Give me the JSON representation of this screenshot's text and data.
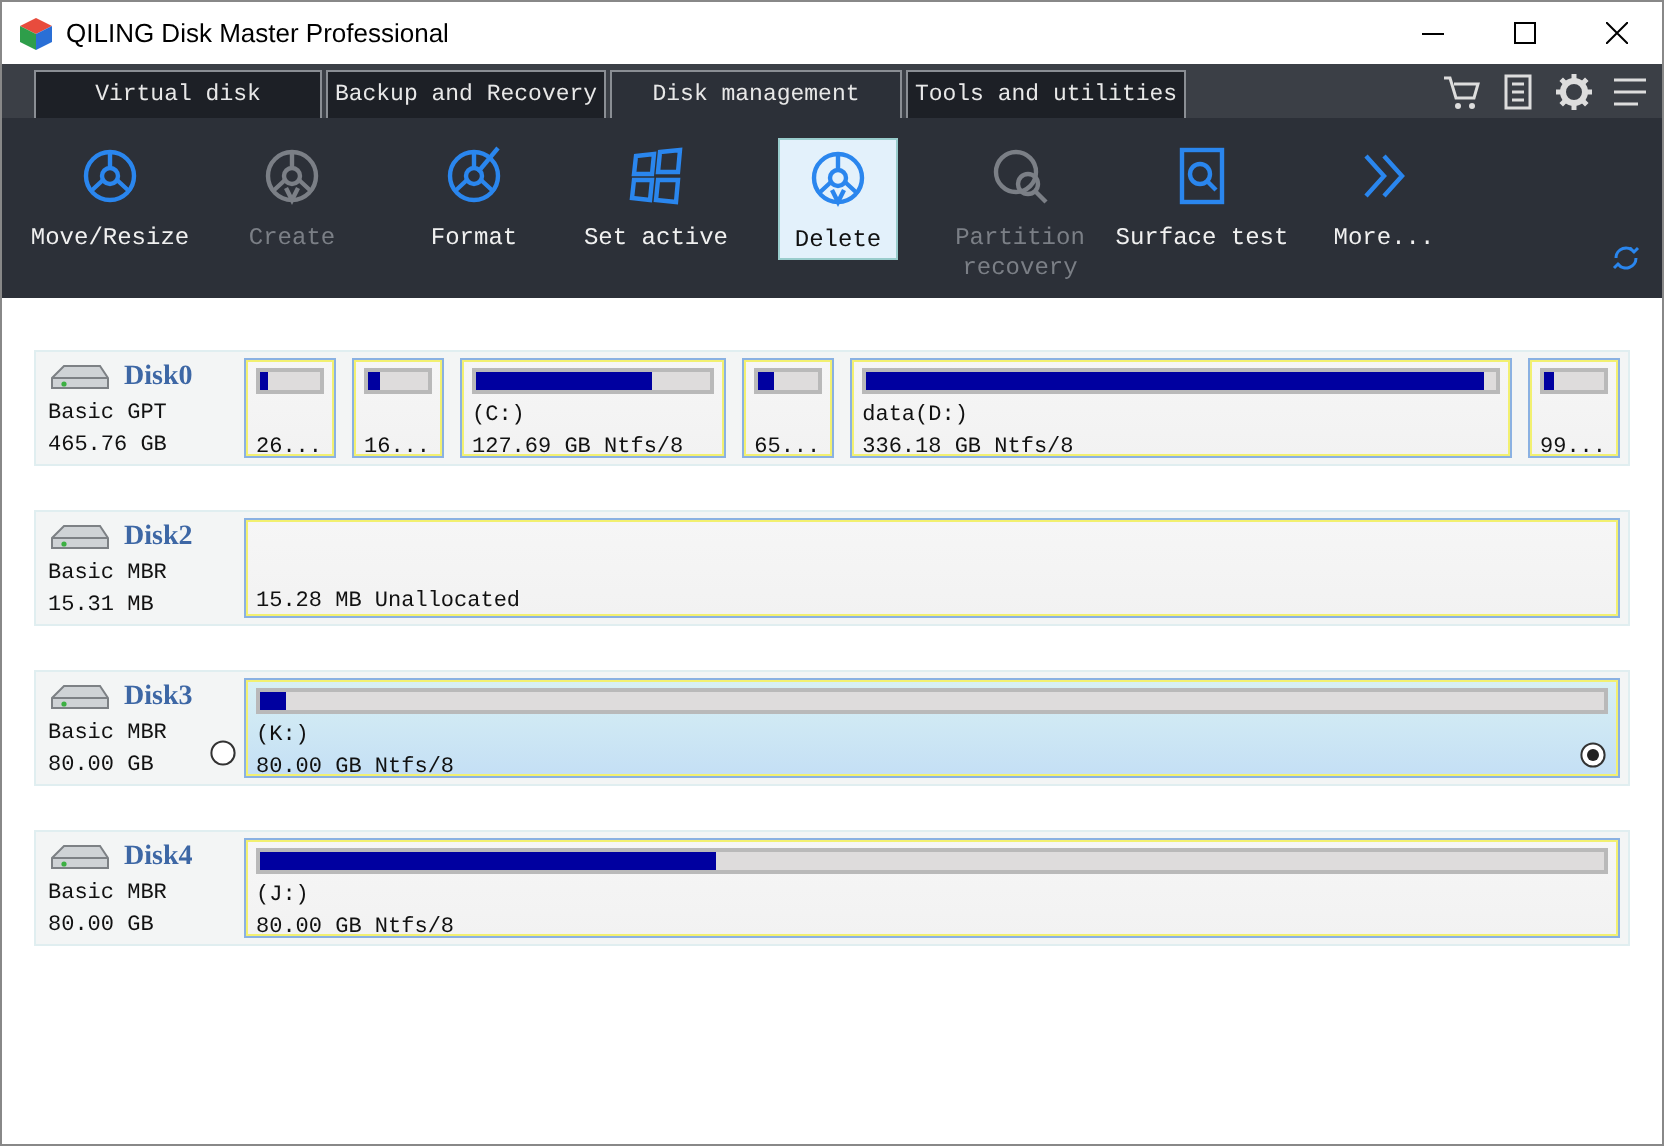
{
  "window": {
    "title": "QILING Disk Master Professional"
  },
  "tabs": [
    {
      "label": "Virtual disk",
      "selected": false
    },
    {
      "label": "Backup and Recovery",
      "selected": false
    },
    {
      "label": "Disk management",
      "selected": true
    },
    {
      "label": "Tools and utilities",
      "selected": false
    }
  ],
  "toolbar": [
    {
      "kind": "move",
      "label": "Move/Resize",
      "disabled": false,
      "selected": false
    },
    {
      "kind": "create",
      "label": "Create",
      "disabled": true,
      "selected": false
    },
    {
      "kind": "format",
      "label": "Format",
      "disabled": false,
      "selected": false
    },
    {
      "kind": "active",
      "label": "Set active",
      "disabled": false,
      "selected": false
    },
    {
      "kind": "delete",
      "label": "Delete",
      "disabled": false,
      "selected": true
    },
    {
      "kind": "recovery",
      "label": "Partition recovery",
      "disabled": true,
      "selected": false
    },
    {
      "kind": "surface",
      "label": "Surface test",
      "disabled": false,
      "selected": false
    },
    {
      "kind": "more",
      "label": "More...",
      "disabled": false,
      "selected": false
    }
  ],
  "disks": [
    {
      "name": "Disk0",
      "type": "Basic GPT",
      "size": "465.76 GB",
      "partitions": [
        {
          "kind": "used",
          "size": "26...",
          "level": 0.12,
          "selected": false
        },
        {
          "kind": "used",
          "size": "16...",
          "level": 0.2,
          "selected": false
        },
        {
          "kind": "used",
          "name": "(C:)",
          "size": "127.69 GB Ntfs/8",
          "level": 0.75,
          "selected": false
        },
        {
          "kind": "used",
          "size": "65...",
          "level": 0.25,
          "selected": false
        },
        {
          "kind": "used",
          "name": "data(D:)",
          "size": "336.18 GB Ntfs/8",
          "level": 0.98,
          "selected": false
        },
        {
          "kind": "used",
          "size": "99...",
          "level": 0.15,
          "selected": false
        }
      ]
    },
    {
      "name": "Disk2",
      "type": "Basic MBR",
      "size": "15.31 MB",
      "partitions": [
        {
          "kind": "unallocated",
          "size": "15.28 MB Unallocated",
          "selected": false
        }
      ]
    },
    {
      "name": "Disk3",
      "type": "Basic MBR",
      "size": "80.00 GB",
      "disk_radio": {
        "selected": false
      },
      "partitions": [
        {
          "kind": "used",
          "name": "(K:)",
          "size": "80.00 GB Ntfs/8",
          "level": 0.02,
          "selected": true
        }
      ]
    },
    {
      "name": "Disk4",
      "type": "Basic MBR",
      "size": "80.00 GB",
      "partitions": [
        {
          "kind": "used",
          "name": "(J:)",
          "size": "80.00 GB Ntfs/8",
          "level": 0.34,
          "selected": false
        }
      ]
    }
  ]
}
